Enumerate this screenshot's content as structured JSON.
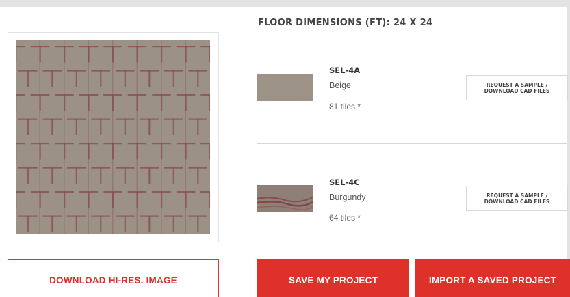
{
  "preview": {
    "image_alt": "T-pattern carpet tile layout preview",
    "tile_base_color": "#9b9185",
    "pattern_color": "#8a4a4c",
    "download_label": "DOWNLOAD HI-RES. IMAGE"
  },
  "floor": {
    "dimensions_title": "FLOOR DIMENSIONS (FT): 24 X 24"
  },
  "tiles": [
    {
      "code": "SEL-4A",
      "color_name": "Beige",
      "count": "81 tiles *",
      "swatch_color": "#9a9183",
      "request_line1": "REQUEST A SAMPLE /",
      "request_line2": "DOWNLOAD CAD FILES"
    },
    {
      "code": "SEL-4C",
      "color_name": "Burgundy",
      "count": "64 tiles *",
      "swatch_color": "#8b7d74",
      "request_line1": "REQUEST A SAMPLE /",
      "request_line2": "DOWNLOAD CAD FILES"
    }
  ],
  "actions": {
    "save_label": "SAVE MY PROJECT",
    "import_label": "IMPORT A SAVED PROJECT",
    "accent_color": "#dd3129"
  }
}
